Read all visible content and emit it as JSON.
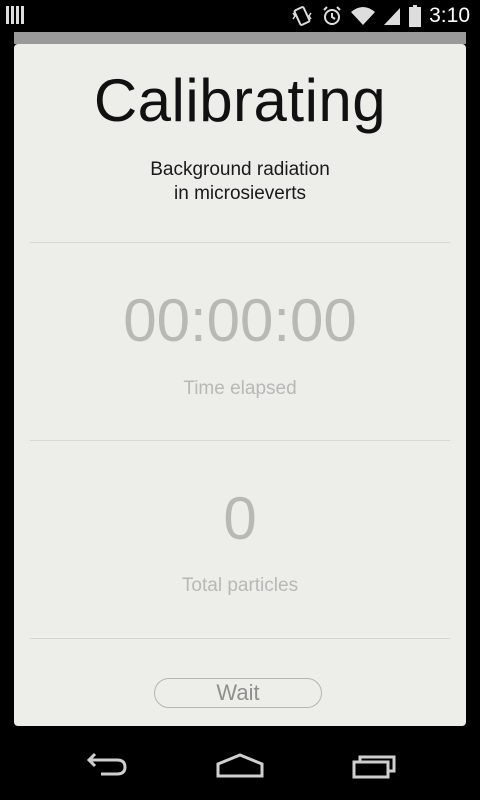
{
  "status_bar": {
    "time": "3:10",
    "icons": [
      "notification-bars-icon",
      "vibrate-icon",
      "alarm-icon",
      "wifi-icon",
      "signal-icon",
      "battery-icon"
    ]
  },
  "calibration": {
    "title": "Calibrating",
    "subtitle_line1": "Background radiation",
    "subtitle_line2": "in microsieverts",
    "time_value": "00:00:00",
    "time_label": "Time elapsed",
    "particles_value": "0",
    "particles_label": "Total particles",
    "button_label": "Wait"
  },
  "nav_bar": {
    "icons": [
      "back-icon",
      "home-icon",
      "recents-icon"
    ]
  },
  "colors": {
    "card_bg": "#ededea",
    "muted_text": "#b8b8b5",
    "title_text": "#111111"
  }
}
